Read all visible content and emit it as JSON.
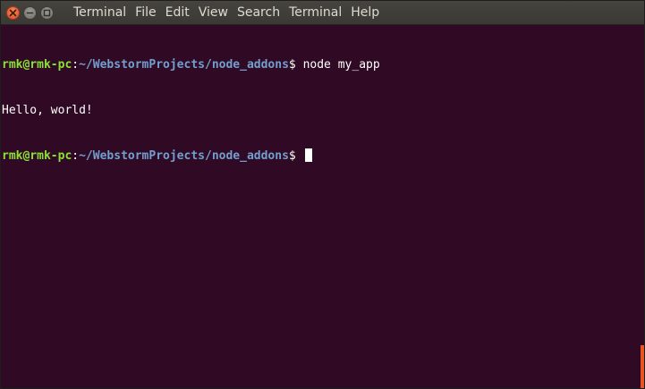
{
  "window": {
    "colors": {
      "terminal_bg": "#300a24",
      "prompt_user": "#8ae234",
      "prompt_path": "#729fcf",
      "scroll_thumb": "#e95420"
    }
  },
  "titlebar": {
    "controls": {
      "close_icon": "close-icon",
      "minimize_icon": "minimize-icon",
      "maximize_icon": "maximize-icon"
    },
    "menu": [
      "Terminal",
      "File",
      "Edit",
      "View",
      "Search",
      "Terminal",
      "Help"
    ]
  },
  "terminal": {
    "lines": [
      {
        "user_host": "rmk@rmk-pc",
        "sep": ":",
        "path": "~/WebstormProjects/node_addons",
        "symbol": "$ ",
        "command": "node my_app"
      },
      {
        "output": "Hello, world!"
      },
      {
        "user_host": "rmk@rmk-pc",
        "sep": ":",
        "path": "~/WebstormProjects/node_addons",
        "symbol": "$ ",
        "command": ""
      }
    ]
  }
}
